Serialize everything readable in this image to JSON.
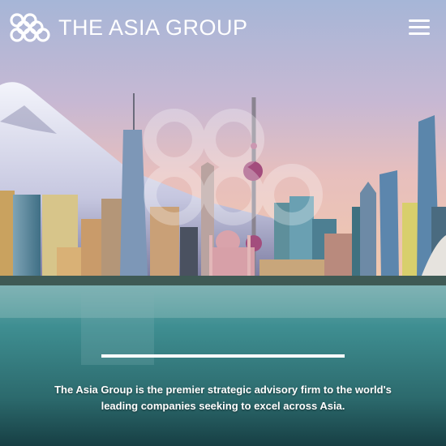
{
  "header": {
    "brand_name": "THE ASIA GROUP",
    "logo_icon": "knot-logo-icon",
    "menu_icon": "hamburger-menu-icon"
  },
  "hero": {
    "tagline": "The Asia Group is the premier strategic advisory firm to the world's leading companies seeking to excel across Asia.",
    "background": "asian-city-skyline-with-mountain-photo"
  },
  "colors": {
    "sky_top": "#a7b8d8",
    "sky_mid": "#d9b7c7",
    "sky_glow": "#f0c8ad",
    "water": "#3f8f92",
    "water_dark": "#1c4a4d",
    "text": "#ffffff"
  }
}
